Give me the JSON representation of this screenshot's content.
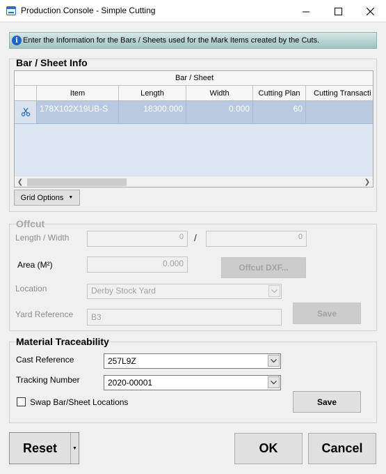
{
  "window": {
    "title": "Production Console - Simple Cutting",
    "minimize_icon": "minimize-icon",
    "maximize_icon": "maximize-icon",
    "close_icon": "close-icon"
  },
  "banner": {
    "icon": "info-icon",
    "text": "Enter the Information for the Bars / Sheets used for the Mark Items created by the Cuts.",
    "accent_color": "#1d63c8"
  },
  "bar_sheet_info": {
    "title": "Bar / Sheet Info",
    "band_label": "Bar / Sheet",
    "columns": [
      "Item",
      "Length",
      "Width",
      "Cutting Plan",
      "Cutting Transacti"
    ],
    "rows": [
      {
        "row_icon": "cut-icon",
        "item": "178X102X19UB-S",
        "length": "18300.000",
        "width": "0.000",
        "cutting_plan": "60",
        "cutting_transaction": ""
      }
    ],
    "grid_options_label": "Grid Options"
  },
  "offcut": {
    "title": "Offcut",
    "length_width_label": "Length / Width",
    "length_value": "0",
    "separator": "/",
    "width_value": "0",
    "area_label": "Area (M²)",
    "area_value": "0.000",
    "offcut_dxf_label": "Offcut DXF...",
    "location_label": "Location",
    "location_value": "Derby Stock Yard",
    "yard_reference_label": "Yard Reference",
    "yard_reference_value": "B3",
    "save_label": "Save"
  },
  "traceability": {
    "title": "Material Traceability",
    "cast_reference_label": "Cast Reference",
    "cast_reference_value": "257L9Z",
    "tracking_number_label": "Tracking Number",
    "tracking_number_value": "2020-00001",
    "swap_label": "Swap Bar/Sheet Locations",
    "swap_checked": false,
    "save_label": "Save"
  },
  "footer": {
    "reset_label": "Reset",
    "ok_label": "OK",
    "cancel_label": "Cancel"
  }
}
